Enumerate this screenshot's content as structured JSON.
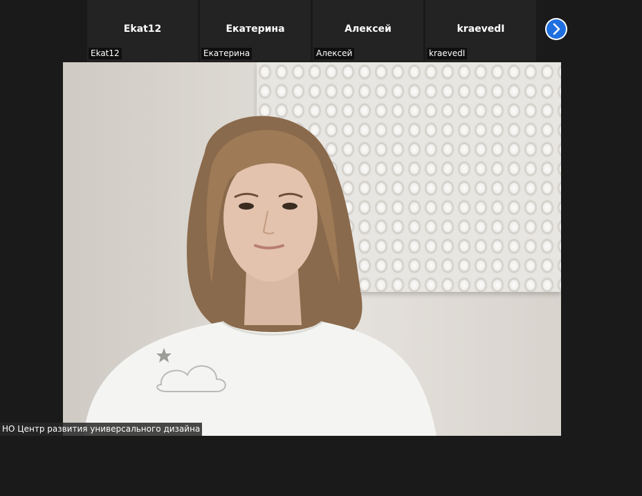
{
  "participants": [
    {
      "name": "Ekat12",
      "label": "Ekat12"
    },
    {
      "name": "Екатерина",
      "label": "Екатерина"
    },
    {
      "name": "Алексей",
      "label": "Алексей"
    },
    {
      "name": "kraevedI",
      "label": "kraevedI"
    }
  ],
  "navigation": {
    "next_icon": "chevron-right-icon",
    "accent_color": "#1f6fe0"
  },
  "speaker": {
    "label": "НО Центр развития универсального дизайна"
  }
}
